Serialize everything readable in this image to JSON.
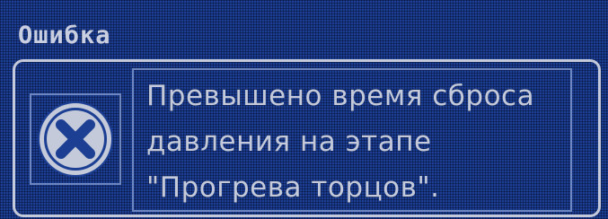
{
  "dialog": {
    "title": "Ошибка",
    "icon": "error-x-circle-icon",
    "message_lines": [
      "Превышено время сброса",
      "давления на этапе",
      "\"Прогрева торцов\"."
    ]
  },
  "colors": {
    "background": "#1c3f93",
    "text": "#c4cad9",
    "frame": "#c4cad9",
    "inner_border": "#6e86bf"
  }
}
